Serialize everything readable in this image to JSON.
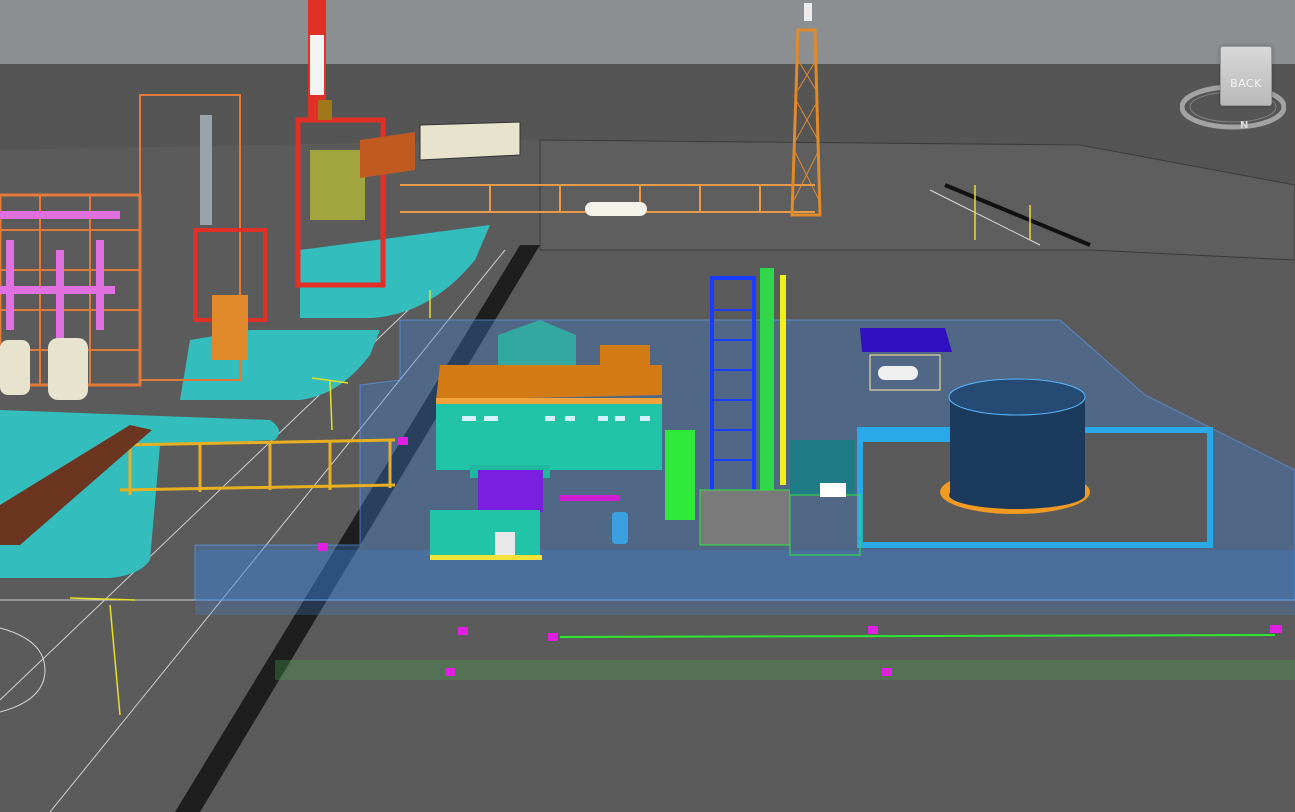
{
  "scene": {
    "sky_color": "#8b8f91",
    "ground_color": "#5a5a5a",
    "pad_color": "#33bdbd",
    "highlight_color": "#3b7fd8",
    "pipe_color": "#e08a2c",
    "rack_color": "#e27a3a",
    "column_color": "#e03028",
    "tank_color": "#1c3a5c"
  },
  "viewcube": {
    "face_label": "BACK",
    "compass_label": "N"
  }
}
